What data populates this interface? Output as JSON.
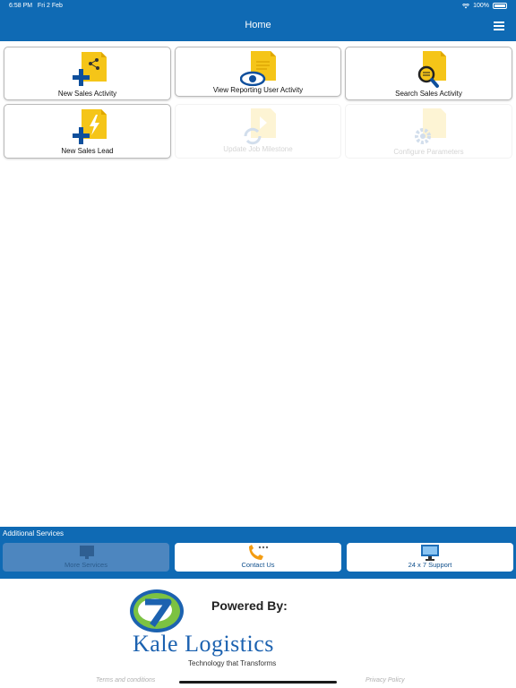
{
  "status_bar": {
    "time": "6:58 PM",
    "date": "Fri 2 Feb",
    "battery": "100%"
  },
  "header": {
    "title": "Home"
  },
  "tiles": [
    {
      "label": "New Sales Activity",
      "icon": "new-sales-activity-icon",
      "enabled": true
    },
    {
      "label": "View Reporting User Activity",
      "icon": "view-reporting-icon",
      "enabled": true
    },
    {
      "label": "Search Sales Activity",
      "icon": "search-sales-icon",
      "enabled": true
    },
    {
      "label": "New Sales Lead",
      "icon": "new-sales-lead-icon",
      "enabled": true
    },
    {
      "label": "Update Job Milestone",
      "icon": "update-milestone-icon",
      "enabled": false
    },
    {
      "label": "Configure Parameters",
      "icon": "configure-parameters-icon",
      "enabled": false
    }
  ],
  "additional": {
    "title": "Additional Services",
    "items": [
      {
        "label": "More Services",
        "icon": "more-services-icon",
        "enabled": false
      },
      {
        "label": "Contact Us",
        "icon": "phone-icon",
        "enabled": true
      },
      {
        "label": "24 x 7 Support",
        "icon": "monitor-support-icon",
        "enabled": true
      }
    ]
  },
  "footer": {
    "powered_by": "Powered By:",
    "brand": "Kale Logistics",
    "tagline": "Technology that Transforms",
    "terms": "Terms and conditions",
    "privacy": "Privacy Policy"
  },
  "colors": {
    "primary": "#0f6ab4",
    "doc_yellow": "#f5c518",
    "brand_blue": "#1c62b0",
    "logo_green": "#7cc242"
  }
}
